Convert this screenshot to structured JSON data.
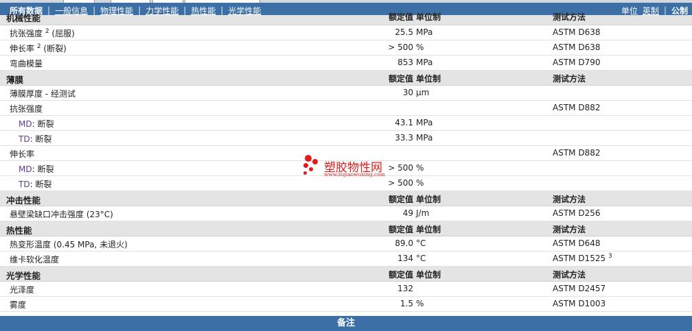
{
  "nav": {
    "items": [
      {
        "label": "所有数据",
        "current": true
      },
      {
        "label": "一般信息"
      },
      {
        "label": "物理性能"
      },
      {
        "label": "力学性能"
      },
      {
        "label": "热性能"
      },
      {
        "label": "光学性能"
      }
    ],
    "separator": "|",
    "units_label": "单位",
    "english": "英制",
    "metric": "公制"
  },
  "header_cols": {
    "nominal": "额定值",
    "unit": "单位制",
    "test": "测试方法"
  },
  "sections": {
    "mechanical": {
      "title": "机械性能",
      "rows": [
        {
          "name": "抗张强度",
          "sup": "2",
          "note": "(屈服)",
          "value": "25.5",
          "unit": "MPa",
          "test": "ASTM D638"
        },
        {
          "name": "伸长率",
          "sup": "2",
          "note": "(断裂)",
          "value": "> 500",
          "unit": "%",
          "test": "ASTM D638"
        },
        {
          "name": "弯曲模量",
          "value": "853",
          "unit": "MPa",
          "test": "ASTM D790"
        }
      ]
    },
    "film": {
      "title": "薄膜",
      "rows": [
        {
          "name": "薄膜厚度 - 经测试",
          "value": "30",
          "unit": "µm",
          "test": ""
        },
        {
          "name": "抗张强度",
          "value": "",
          "unit": "",
          "test": "ASTM D882"
        },
        {
          "prefix": "MD",
          "name": ": 断裂",
          "value": "43.1",
          "unit": "MPa",
          "test": ""
        },
        {
          "prefix": "TD",
          "name": ": 断裂",
          "value": "33.3",
          "unit": "MPa",
          "test": ""
        },
        {
          "name": "伸长率",
          "value": "",
          "unit": "",
          "test": "ASTM D882"
        },
        {
          "prefix": "MD",
          "name": ": 断裂",
          "value": "> 500",
          "unit": "%",
          "test": ""
        },
        {
          "prefix": "TD",
          "name": ": 断裂",
          "value": "> 500",
          "unit": "%",
          "test": ""
        }
      ]
    },
    "impact": {
      "title": "冲击性能",
      "rows": [
        {
          "name": "悬壁梁缺口冲击强度 (23°C)",
          "value": "49",
          "unit": "J/m",
          "test": "ASTM D256"
        }
      ]
    },
    "thermal": {
      "title": "热性能",
      "rows": [
        {
          "name": "热变形温度 (0.45 MPa, 未退火)",
          "value": "89.0",
          "unit": "°C",
          "test": "ASTM D648"
        },
        {
          "name": "维卡软化温度",
          "value": "134",
          "unit": "°C",
          "test": "ASTM D1525",
          "test_sup": "3"
        }
      ]
    },
    "optical": {
      "title": "光学性能",
      "rows": [
        {
          "name": "光泽度",
          "value": "132",
          "unit": "",
          "test": "ASTM D2457"
        },
        {
          "name": "雾度",
          "value": "1.5",
          "unit": "%",
          "test": "ASTM D1003"
        }
      ]
    }
  },
  "footer": {
    "label": "备注"
  },
  "watermark": {
    "text": "塑胶物性网",
    "url": "www.sujiaowuxing.com",
    "color": "#e21b1b"
  }
}
